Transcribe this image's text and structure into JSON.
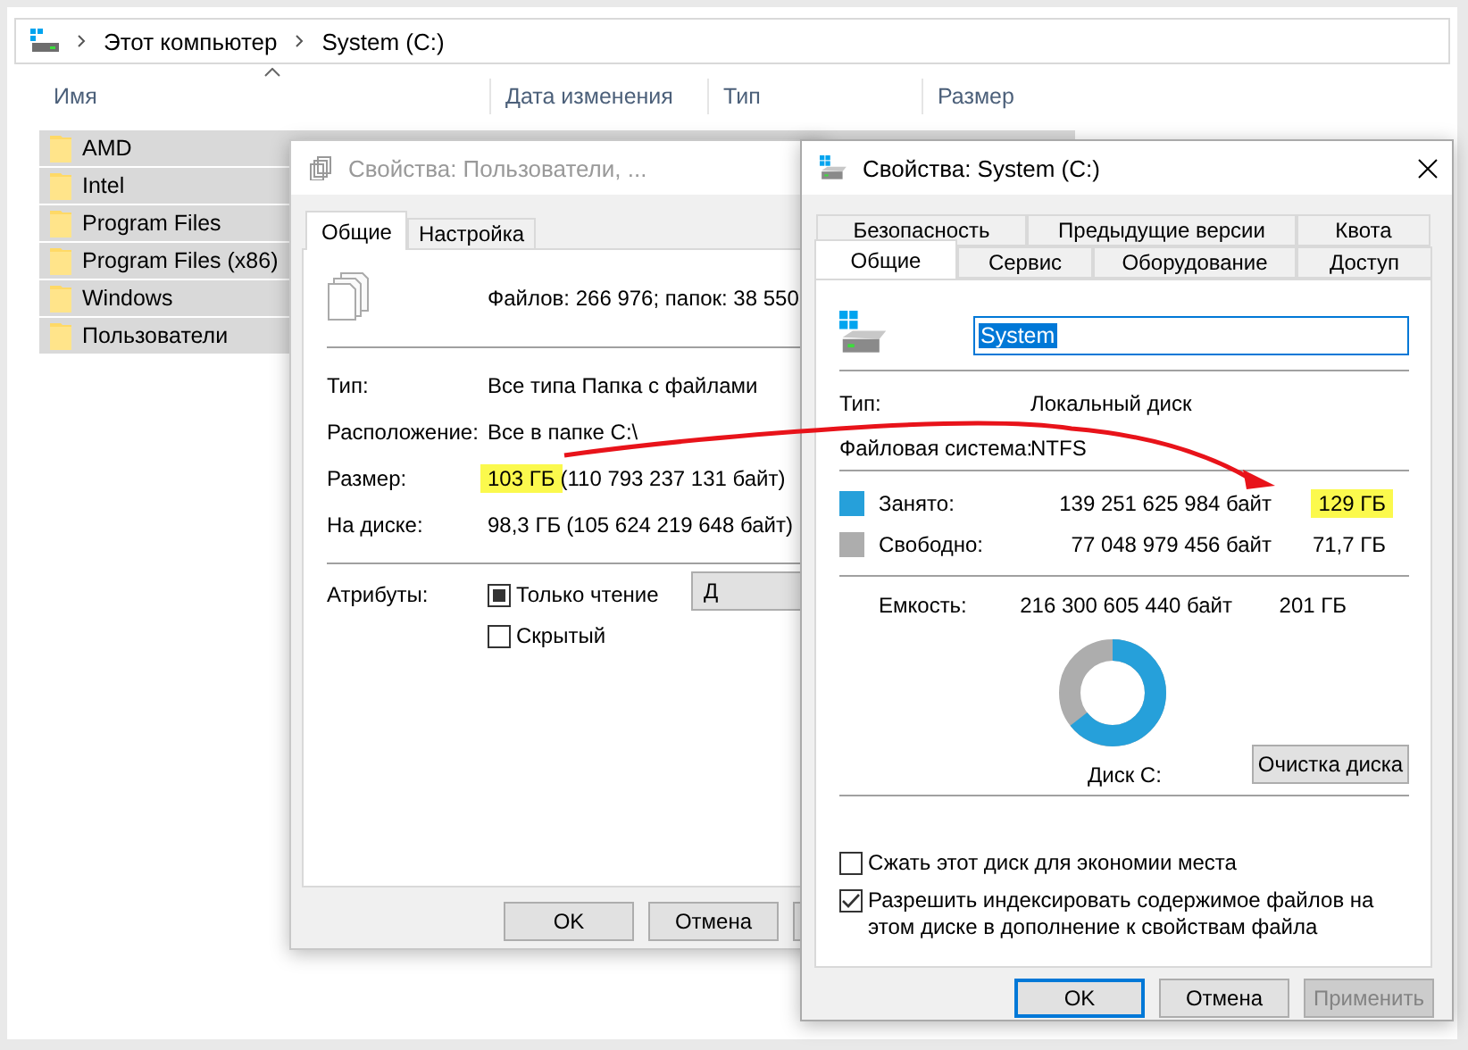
{
  "explorer": {
    "breadcrumb": [
      "Этот компьютер",
      "System (C:)"
    ],
    "columns": [
      "Имя",
      "Дата изменения",
      "Тип",
      "Размер"
    ],
    "rows": [
      {
        "name": "AMD",
        "selected": true
      },
      {
        "name": "Intel",
        "selected": true
      },
      {
        "name": "Program Files",
        "selected": true
      },
      {
        "name": "Program Files (x86)",
        "selected": true
      },
      {
        "name": "Windows",
        "selected": true
      },
      {
        "name": "Пользователи",
        "selected": true
      }
    ]
  },
  "folder_dialog": {
    "title": "Свойства: Пользователи, ...",
    "active": false,
    "tabs": [
      {
        "label": "Общие",
        "selected": true
      },
      {
        "label": "Настройка",
        "selected": false
      }
    ],
    "summary": "Файлов: 266 976; папок: 38 550",
    "fields": [
      {
        "label": "Тип:",
        "value": "Все типа Папка с файлами",
        "highlighted": false
      },
      {
        "label": "Расположение:",
        "value": "Все в папке C:\\",
        "highlighted": false
      },
      {
        "label": "Размер:",
        "value": "103 ГБ",
        "highlighted": true,
        "detail": "(110 793 237 131 байт)"
      },
      {
        "label": "На диске:",
        "value": "98,3 ГБ",
        "highlighted": false,
        "detail": "(105 624 219 648 байт)"
      }
    ],
    "attributes_label": "Атрибуты:",
    "attributes": [
      {
        "label": "Только чтение",
        "checked": false,
        "indeterminate": true
      },
      {
        "label": "Скрытый",
        "checked": false,
        "indeterminate": false
      }
    ],
    "other_button": "Д",
    "buttons": [
      "OK",
      "Отмена"
    ]
  },
  "disk_dialog": {
    "title": "Свойства: System (C:)",
    "active": true,
    "tab_rows": [
      [
        {
          "label": "Безопасность",
          "selected": false
        },
        {
          "label": "Предыдущие версии",
          "selected": false
        },
        {
          "label": "Квота",
          "selected": false
        }
      ],
      [
        {
          "label": "Общие",
          "selected": true
        },
        {
          "label": "Сервис",
          "selected": false
        },
        {
          "label": "Оборудование",
          "selected": false
        },
        {
          "label": "Доступ",
          "selected": false
        }
      ]
    ],
    "name": "System",
    "type_label": "Тип:",
    "type": "Локальный диск",
    "fs_label": "Файловая система:",
    "fs": "NTFS",
    "usage": [
      {
        "label": "Занято:",
        "bytes": "139 251 625 984 байт",
        "size": "129 ГБ",
        "highlighted": true,
        "color": "#26a0da"
      },
      {
        "label": "Свободно:",
        "bytes": "77 048 979 456 байт",
        "size": "71,7 ГБ",
        "highlighted": false,
        "color": "#adadad"
      }
    ],
    "capacity": {
      "label": "Емкость:",
      "bytes": "216 300 605 440 байт",
      "size": "201 ГБ"
    },
    "disk": {
      "label": "Диск C:",
      "level": 0.644
    },
    "cleanup_button": "Очистка диска",
    "options": [
      {
        "label": "Сжать этот диск для экономии места",
        "checked": false
      },
      {
        "label": "Разрешить индексировать содержимое файлов на этом диске в дополнение к свойствам файла",
        "checked": true
      }
    ],
    "buttons": [
      {
        "label": "OK",
        "default": true,
        "disabled": false
      },
      {
        "label": "Отмена",
        "default": false,
        "disabled": false
      },
      {
        "label": "Применить",
        "default": false,
        "disabled": true
      }
    ]
  }
}
